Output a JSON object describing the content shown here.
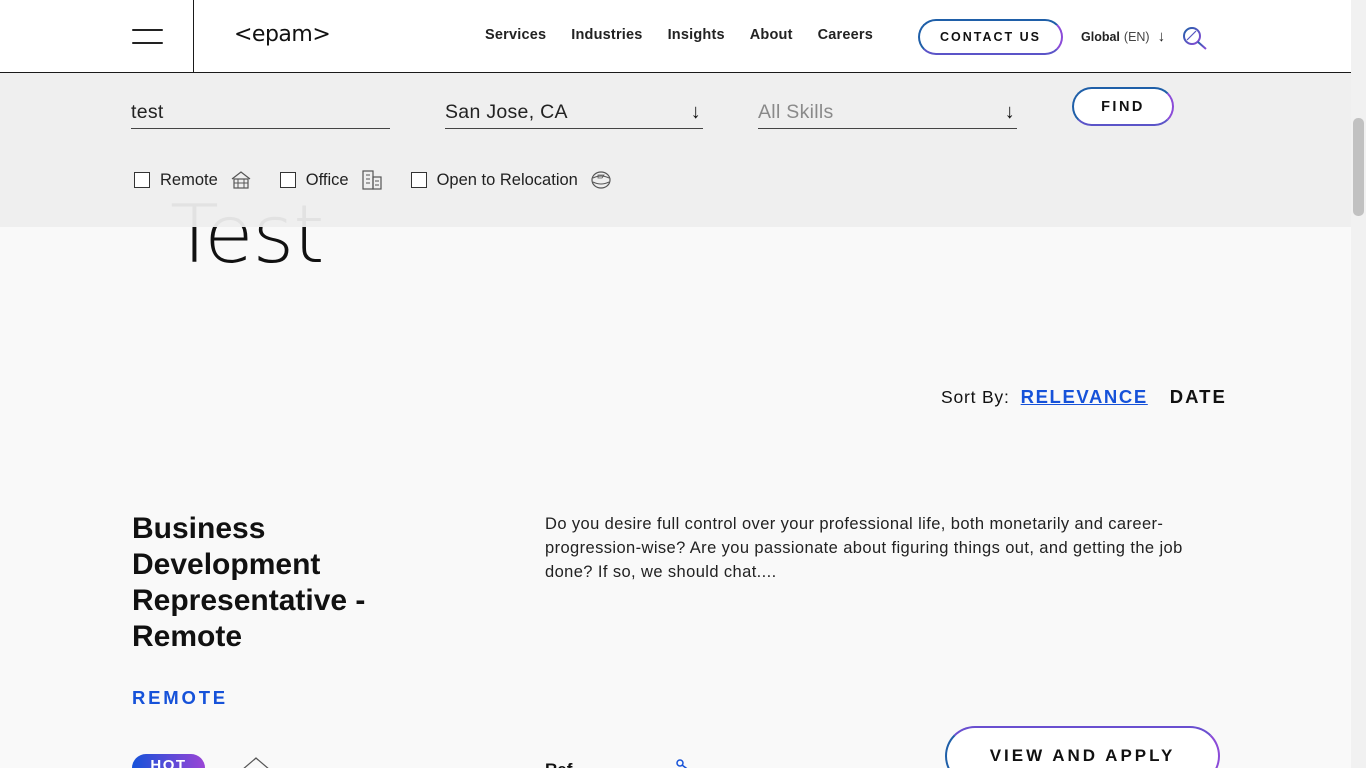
{
  "header": {
    "logo": "<epam>",
    "nav": [
      "Services",
      "Industries",
      "Insights",
      "About",
      "Careers"
    ],
    "contact_label": "CONTACT US",
    "lang_region": "Global",
    "lang_code": "(EN)"
  },
  "filter": {
    "keyword_value": "test",
    "location_value": "San Jose, CA",
    "skills_placeholder": "All Skills",
    "find_label": "FIND",
    "checkboxes": [
      {
        "label": "Remote",
        "checked": false,
        "icon": "home-icon"
      },
      {
        "label": "Office",
        "checked": false,
        "icon": "building-icon"
      },
      {
        "label": "Open to Relocation",
        "checked": false,
        "icon": "globe-icon"
      }
    ]
  },
  "hero": {
    "query": "Test"
  },
  "sort": {
    "label": "Sort By:",
    "relevance": "RELEVANCE",
    "date": "DATE",
    "active": "RELEVANCE"
  },
  "job": {
    "title": "Business Development Representative - Remote",
    "description": "Do you desire full control over your professional life, both monetarily and career-progression-wise? Are you passionate about figuring things out, and getting the job done? If so, we should chat....",
    "type": "REMOTE",
    "badge": "HOT",
    "referral": "Ref",
    "apply_label": "VIEW AND APPLY"
  },
  "colors": {
    "accent_blue": "#1652d9",
    "accent_purple": "#9a45d6"
  }
}
